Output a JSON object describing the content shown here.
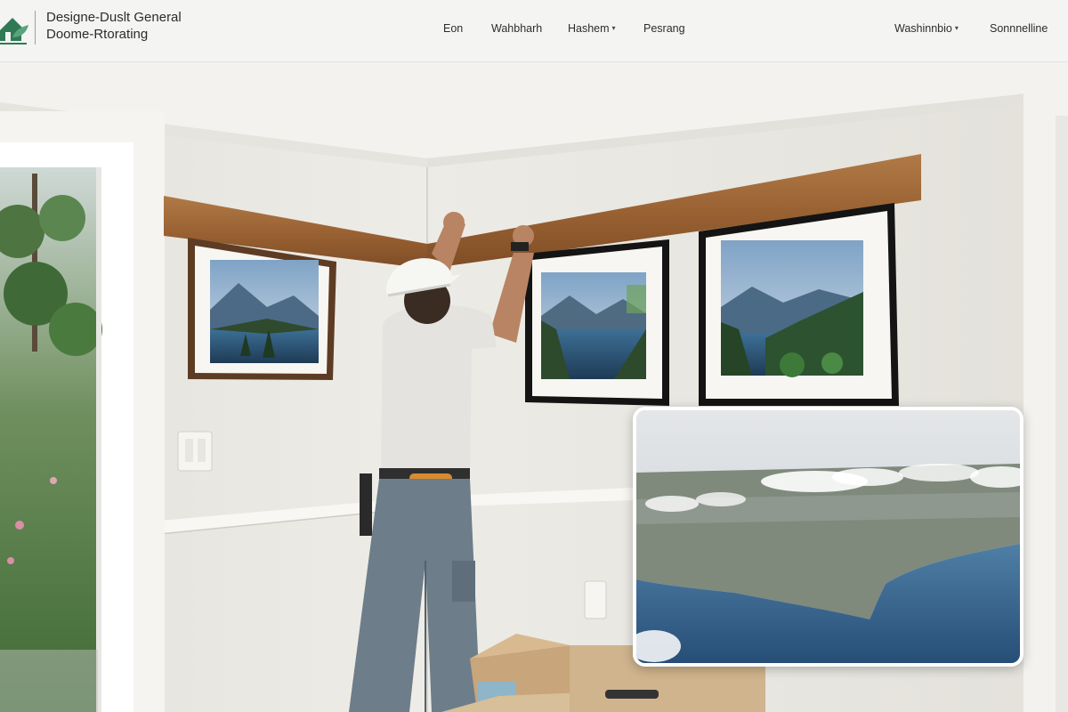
{
  "header": {
    "brand_line1": "Designe-Duslt General",
    "brand_line2": "Doome-Rtorating",
    "logo_icon": "house-leaf-logo-icon",
    "nav": [
      {
        "label": "Eon",
        "dropdown": false
      },
      {
        "label": "Wahbharh",
        "dropdown": false
      },
      {
        "label": "Hashem",
        "dropdown": true
      },
      {
        "label": "Pesrang",
        "dropdown": false
      },
      {
        "label": "Washinnbio",
        "dropdown": true
      },
      {
        "label": "Sonnnelline",
        "dropdown": false
      }
    ]
  },
  "colors": {
    "header_bg": "#f4f4f2",
    "accent_green": "#2f7a55",
    "wall": "#e9e7e1",
    "molding_wood": "#a06a3c"
  },
  "hero": {
    "inset_icon": "aerial-coastline-photo"
  }
}
